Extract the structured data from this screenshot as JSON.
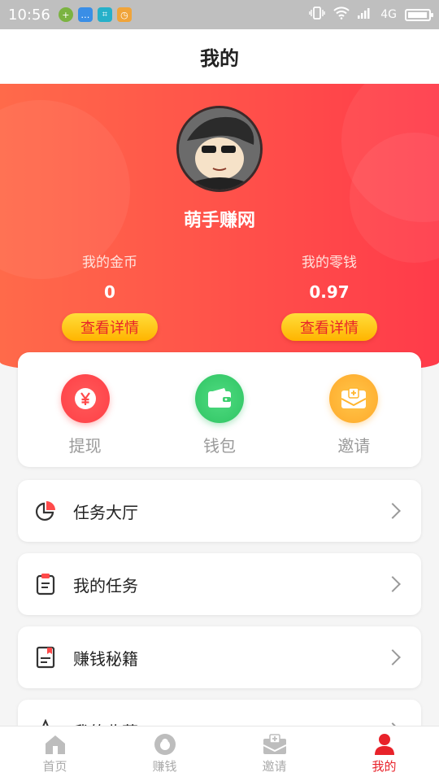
{
  "status_bar": {
    "time": "10:56",
    "network": "4G",
    "battery_percent": 95
  },
  "header": {
    "title": "我的"
  },
  "profile": {
    "username": "萌手赚网",
    "coins": {
      "label": "我的金币",
      "value": "0",
      "button": "查看详情"
    },
    "change": {
      "label": "我的零钱",
      "value": "0.97",
      "button": "查看详情"
    }
  },
  "quick_actions": [
    {
      "label": "提现",
      "icon": "yen-icon",
      "color": "#ff4a4a"
    },
    {
      "label": "钱包",
      "icon": "wallet-icon",
      "color": "#3ccf6e"
    },
    {
      "label": "邀请",
      "icon": "envelope-icon",
      "color": "#ffb52e"
    }
  ],
  "menu": [
    {
      "label": "任务大厅",
      "icon": "pie-chart-icon"
    },
    {
      "label": "我的任务",
      "icon": "clipboard-icon"
    },
    {
      "label": "赚钱秘籍",
      "icon": "book-icon"
    },
    {
      "label": "我的收藏",
      "icon": "star-icon"
    }
  ],
  "tab_bar": {
    "active_color": "#e8222a",
    "tabs": [
      {
        "label": "首页",
        "icon": "home-icon"
      },
      {
        "label": "赚钱",
        "icon": "money-bag-icon"
      },
      {
        "label": "邀请",
        "icon": "inbox-icon"
      },
      {
        "label": "我的",
        "icon": "user-icon"
      }
    ]
  }
}
